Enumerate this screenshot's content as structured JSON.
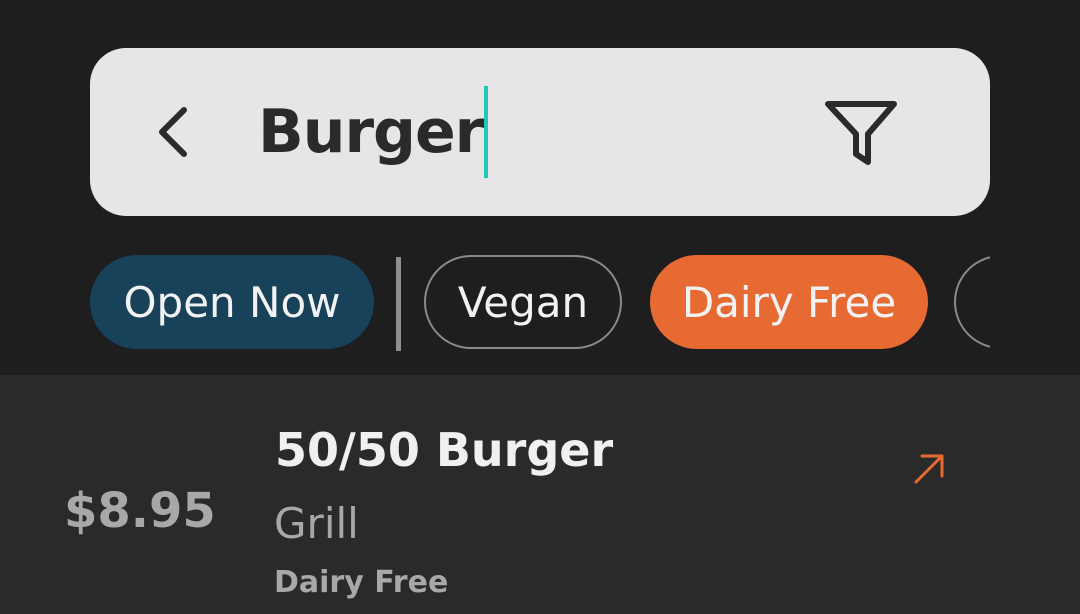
{
  "search": {
    "query": "Burger",
    "back_icon": "chevron-left-icon",
    "filter_icon": "filter-funnel-icon",
    "caret_color": "#1fc8b8"
  },
  "chips": [
    {
      "label": "Open Now",
      "selected": true,
      "color": "#17425a"
    },
    {
      "label": "Vegan",
      "selected": false
    },
    {
      "label": "Dairy Free",
      "selected": true,
      "color": "#e86a33"
    },
    {
      "label": "",
      "selected": false
    }
  ],
  "result": {
    "price": "$8.95",
    "title": "50/50 Burger",
    "category": "Grill",
    "tag": "Dairy Free",
    "open_icon": "arrow-up-right-icon",
    "accent": "#e86a33"
  }
}
